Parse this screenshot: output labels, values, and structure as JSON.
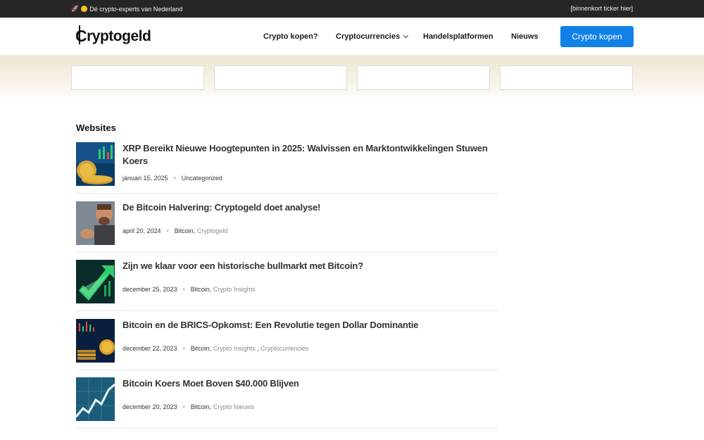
{
  "topbar": {
    "tagline": "Dé crypto-experts van Nederland",
    "ticker": "[binnenkort ticker hier]"
  },
  "header": {
    "logo": "ryptogeld",
    "nav": [
      "Crypto kopen?",
      "Cryptocurrencies",
      "Handelsplatformen",
      "Nieuws"
    ],
    "cta": "Crypto kopen"
  },
  "section": {
    "title": "Websites"
  },
  "posts": [
    {
      "title": "XRP Bereikt Nieuwe Hoogtepunten in 2025: Walvissen en Marktontwikkelingen Stuwen Koers",
      "date": "januari 15, 2025",
      "cat1": "Uncategorized",
      "cat2": "",
      "cat3": ""
    },
    {
      "title": "De Bitcoin Halvering: Cryptogeld doet analyse!",
      "date": "april 20, 2024",
      "cat1": "Bitcoin",
      "cat2": "Cryptogeld",
      "cat3": ""
    },
    {
      "title": "Zijn we klaar voor een historische bullmarkt met Bitcoin?",
      "date": "december 25, 2023",
      "cat1": "Bitcoin",
      "cat2": "Crypto Insights",
      "cat3": ""
    },
    {
      "title": "Bitcoin en de BRICS-Opkomst: Een Revolutie tegen Dollar Dominantie",
      "date": "december 22, 2023",
      "cat1": "Bitcoin",
      "cat2": "Crypto Insights",
      "cat3": "Cryptocurrencies"
    },
    {
      "title": "Bitcoin Koers Moet Boven $40.000 Blijven",
      "date": "december 20, 2023",
      "cat1": "Bitcoin",
      "cat2": "Crypto Nieuws",
      "cat3": ""
    }
  ]
}
